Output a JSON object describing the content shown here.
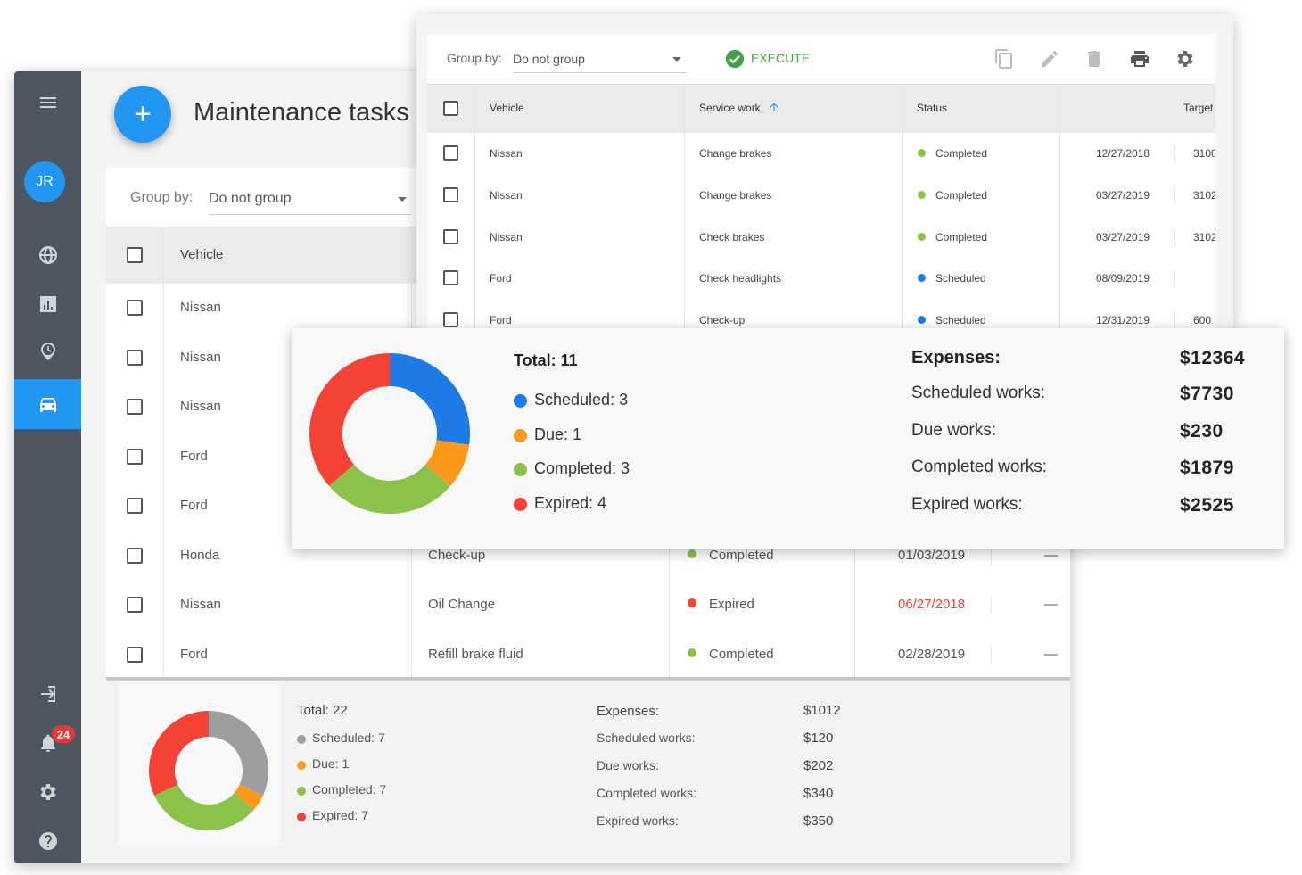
{
  "app": {
    "title": "Maintenance tasks",
    "avatar_initials": "JR",
    "notification_count": "24",
    "add_button": "+"
  },
  "colors": {
    "accent": "#2196f3",
    "scheduled": "#1e7be6",
    "due": "#fb9a1a",
    "completed": "#8bc34a",
    "expired": "#f44336",
    "gray": "#9e9e9e",
    "expired_date": "#f44336",
    "execute": "#43a047"
  },
  "sidebar": {
    "icons": [
      "menu-icon",
      "globe-icon",
      "chart-icon",
      "clock-icon",
      "car-icon",
      "logout-icon",
      "bell-icon",
      "gear-icon",
      "help-icon"
    ],
    "active": "car-icon"
  },
  "back": {
    "group_by_label": "Group by:",
    "group_by_value": "Do not group",
    "header_vehicle": "Vehicle",
    "rows": [
      {
        "vehicle": "Nissan",
        "service": "",
        "status": "",
        "status_color": "",
        "date": "",
        "dash": ""
      },
      {
        "vehicle": "Nissan",
        "service": "",
        "status": "",
        "status_color": "",
        "date": "",
        "dash": ""
      },
      {
        "vehicle": "Nissan",
        "service": "",
        "status": "",
        "status_color": "",
        "date": "",
        "dash": ""
      },
      {
        "vehicle": "Ford",
        "service": "",
        "status": "",
        "status_color": "",
        "date": "",
        "dash": ""
      },
      {
        "vehicle": "Ford",
        "service": "",
        "status": "",
        "status_color": "",
        "date": "",
        "dash": ""
      },
      {
        "vehicle": "Honda",
        "service": "Check-up",
        "status": "Completed",
        "status_color": "#8bc34a",
        "date": "01/03/2019",
        "dash": "—"
      },
      {
        "vehicle": "Nissan",
        "service": "Oil Change",
        "status": "Expired",
        "status_color": "#f44336",
        "date": "06/27/2018",
        "dash": "—",
        "date_expired": true
      },
      {
        "vehicle": "Ford",
        "service": "Refill brake fluid",
        "status": "Completed",
        "status_color": "#8bc34a",
        "date": "02/28/2019",
        "dash": "—"
      }
    ],
    "summary": {
      "total": "Total: 22",
      "legend": [
        {
          "label": "Scheduled: 7",
          "color": "#9e9e9e",
          "value": 7
        },
        {
          "label": "Due: 1",
          "color": "#fb9a1a",
          "value": 1
        },
        {
          "label": "Completed: 7",
          "color": "#8bc34a",
          "value": 7
        },
        {
          "label": "Expired: 7",
          "color": "#f44336",
          "value": 7
        }
      ],
      "expenses_label": "Expenses:",
      "expenses_value": "$1012",
      "lines": [
        {
          "label": "Scheduled works:",
          "value": "$120"
        },
        {
          "label": "Due works:",
          "value": "$202"
        },
        {
          "label": "Completed works:",
          "value": "$340"
        },
        {
          "label": "Expired works:",
          "value": "$350"
        }
      ]
    }
  },
  "top": {
    "group_by_label": "Group by:",
    "group_by_value": "Do not group",
    "execute_label": "EXECUTE",
    "toolbar_icons": [
      "copy-icon",
      "edit-icon",
      "delete-icon",
      "print-icon",
      "settings-icon"
    ],
    "headers": {
      "vehicle": "Vehicle",
      "service": "Service work",
      "status": "Status",
      "target": "Target"
    },
    "rows": [
      {
        "vehicle": "Nissan",
        "service": "Change brakes",
        "status": "Completed",
        "status_color": "#8bc34a",
        "date": "12/27/2018",
        "target": "3100"
      },
      {
        "vehicle": "Nissan",
        "service": "Change brakes",
        "status": "Completed",
        "status_color": "#8bc34a",
        "date": "03/27/2019",
        "target": "3102"
      },
      {
        "vehicle": "Nissan",
        "service": "Check brakes",
        "status": "Completed",
        "status_color": "#8bc34a",
        "date": "03/27/2019",
        "target": "3102"
      },
      {
        "vehicle": "Ford",
        "service": "Check headlights",
        "status": "Scheduled",
        "status_color": "#1e7be6",
        "date": "08/09/2019",
        "target": ""
      },
      {
        "vehicle": "Ford",
        "service": "Check-up",
        "status": "Scheduled",
        "status_color": "#1e7be6",
        "date": "12/31/2019",
        "target": "600"
      }
    ]
  },
  "card": {
    "total": "Total: 11",
    "legend": [
      {
        "label": "Scheduled: 3",
        "color": "#1e7be6",
        "value": 3
      },
      {
        "label": "Due: 1",
        "color": "#fb9a1a",
        "value": 1
      },
      {
        "label": "Completed: 3",
        "color": "#8bc34a",
        "value": 3
      },
      {
        "label": "Expired: 4",
        "color": "#f44336",
        "value": 4
      }
    ],
    "expenses_label": "Expenses:",
    "expenses_value": "$12364",
    "lines": [
      {
        "label": "Scheduled works:",
        "value": "$7730"
      },
      {
        "label": "Due works:",
        "value": "$230"
      },
      {
        "label": "Completed works:",
        "value": "$1879"
      },
      {
        "label": "Expired works:",
        "value": "$2525"
      }
    ]
  }
}
